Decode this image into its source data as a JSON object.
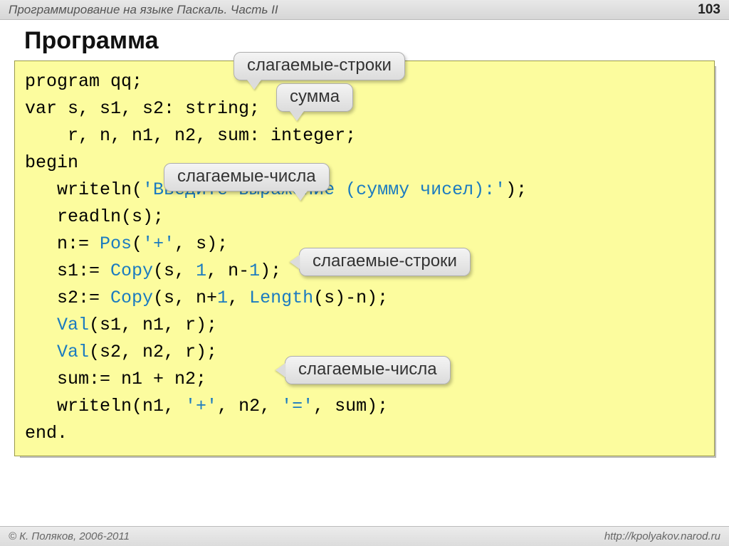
{
  "header": {
    "title": "Программирование на языке Паскаль. Часть II",
    "page": "103"
  },
  "slide_title": "Программа",
  "callouts": {
    "c1": "слагаемые-строки",
    "c2": "сумма",
    "c3": "слагаемые-числа",
    "c4": "слагаемые-строки",
    "c5": "слагаемые-числа"
  },
  "code": {
    "l1": "program qq;",
    "l2": "var s, s1, s2: string;",
    "l3": "    r, n, n1, n2, sum: integer;",
    "l4": "begin",
    "l5a": "   writeln(",
    "l5b": "'Введите выражение (сумму чисел):'",
    "l5c": ");",
    "l6": "   readln(s);",
    "l7a": "   n:= ",
    "l7b": "Pos",
    "l7c": "(",
    "l7d": "'+'",
    "l7e": ", s);",
    "l8a": "   s1:= ",
    "l8b": "Copy",
    "l8c": "(s, ",
    "l8d": "1",
    "l8e": ", n-",
    "l8f": "1",
    "l8g": ");",
    "l9a": "   s2:= ",
    "l9b": "Copy",
    "l9c": "(s, n+",
    "l9d": "1",
    "l9e": ", ",
    "l9f": "Length",
    "l9g": "(s)-n);",
    "l10a": "   ",
    "l10b": "Val",
    "l10c": "(s1, n1, r);",
    "l11a": "   ",
    "l11b": "Val",
    "l11c": "(s2, n2, r);",
    "l12": "   sum:= n1 + n2;",
    "l13a": "   writeln(n1, ",
    "l13b": "'+'",
    "l13c": ", n2, ",
    "l13d": "'='",
    "l13e": ", sum);",
    "l14": "end."
  },
  "footer": {
    "copyright": "© К. Поляков, 2006-2011",
    "url": "http://kpolyakov.narod.ru"
  }
}
